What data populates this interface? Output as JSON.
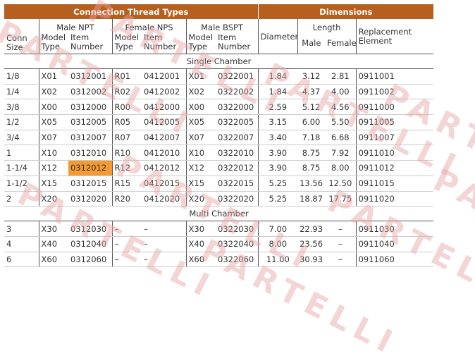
{
  "header": {
    "connection": "Connection Thread Types",
    "dimensions": "Dimensions"
  },
  "columns": {
    "conn_size": "Conn Size",
    "male_npt": "Male NPT",
    "female_nps": "Female NPS",
    "male_bspt": "Male BSPT",
    "diameter": "Diameter",
    "length": "Length",
    "replacement": "Replacement Element",
    "model_type": "Model Type",
    "item_number": "Item Number",
    "male": "Male",
    "female": "Female"
  },
  "sections": [
    {
      "title": "Single Chamber",
      "rows": [
        [
          "1/8",
          "X01",
          "0312001",
          "R01",
          "0412001",
          "X01",
          "0322001",
          "1.84",
          "3.12",
          "2.81",
          "0911001"
        ],
        [
          "1/4",
          "X02",
          "0312002",
          "R02",
          "0412002",
          "X02",
          "0322002",
          "1.84",
          "4.37",
          "4.00",
          "0911002"
        ],
        [
          "3/8",
          "X00",
          "0312000",
          "R00",
          "0412000",
          "X00",
          "0322000",
          "2.59",
          "5.12",
          "4.56",
          "0911000"
        ],
        [
          "1/2",
          "X05",
          "0312005",
          "R05",
          "0412005",
          "X05",
          "0322005",
          "3.15",
          "6.00",
          "5.50",
          "0911005"
        ],
        [
          "3/4",
          "X07",
          "0312007",
          "R07",
          "0412007",
          "X07",
          "0322007",
          "3.40",
          "7.18",
          "6.68",
          "0911007"
        ],
        [
          "1",
          "X10",
          "0312010",
          "R10",
          "0412010",
          "X10",
          "0322010",
          "3.90",
          "8.75",
          "7.92",
          "0911010"
        ],
        [
          "1-1/4",
          "X12",
          "0312012",
          "R12",
          "0412012",
          "X12",
          "0322012",
          "3.90",
          "8.75",
          "8.00",
          "0911012"
        ],
        [
          "1-1/2",
          "X15",
          "0312015",
          "R15",
          "0412015",
          "X15",
          "0322015",
          "5.25",
          "13.56",
          "12.50",
          "0911015"
        ],
        [
          "2",
          "X20",
          "0312020",
          "R20",
          "0412020",
          "X20",
          "0322020",
          "5.25",
          "18.87",
          "17.75",
          "0911020"
        ]
      ]
    },
    {
      "title": "Multi Chamber",
      "rows": [
        [
          "3",
          "X30",
          "0312030",
          "–",
          "–",
          "X30",
          "0322030",
          "7.00",
          "22.93",
          "–",
          "0911030"
        ],
        [
          "4",
          "X40",
          "0312040",
          "–",
          "–",
          "X40",
          "0322040",
          "8.00",
          "23.56",
          "–",
          "0911040"
        ],
        [
          "6",
          "X60",
          "0312060",
          "–",
          "–",
          "X60",
          "0322060",
          "11.00",
          "30.93",
          "–",
          "0911060"
        ]
      ]
    }
  ],
  "highlight": {
    "section": 0,
    "row": 6,
    "col": 2
  },
  "watermark": "PARTELLI",
  "colors": {
    "header_bg": "#b5601f",
    "highlight": "#f39b30",
    "watermark": "#e6a3a3"
  }
}
